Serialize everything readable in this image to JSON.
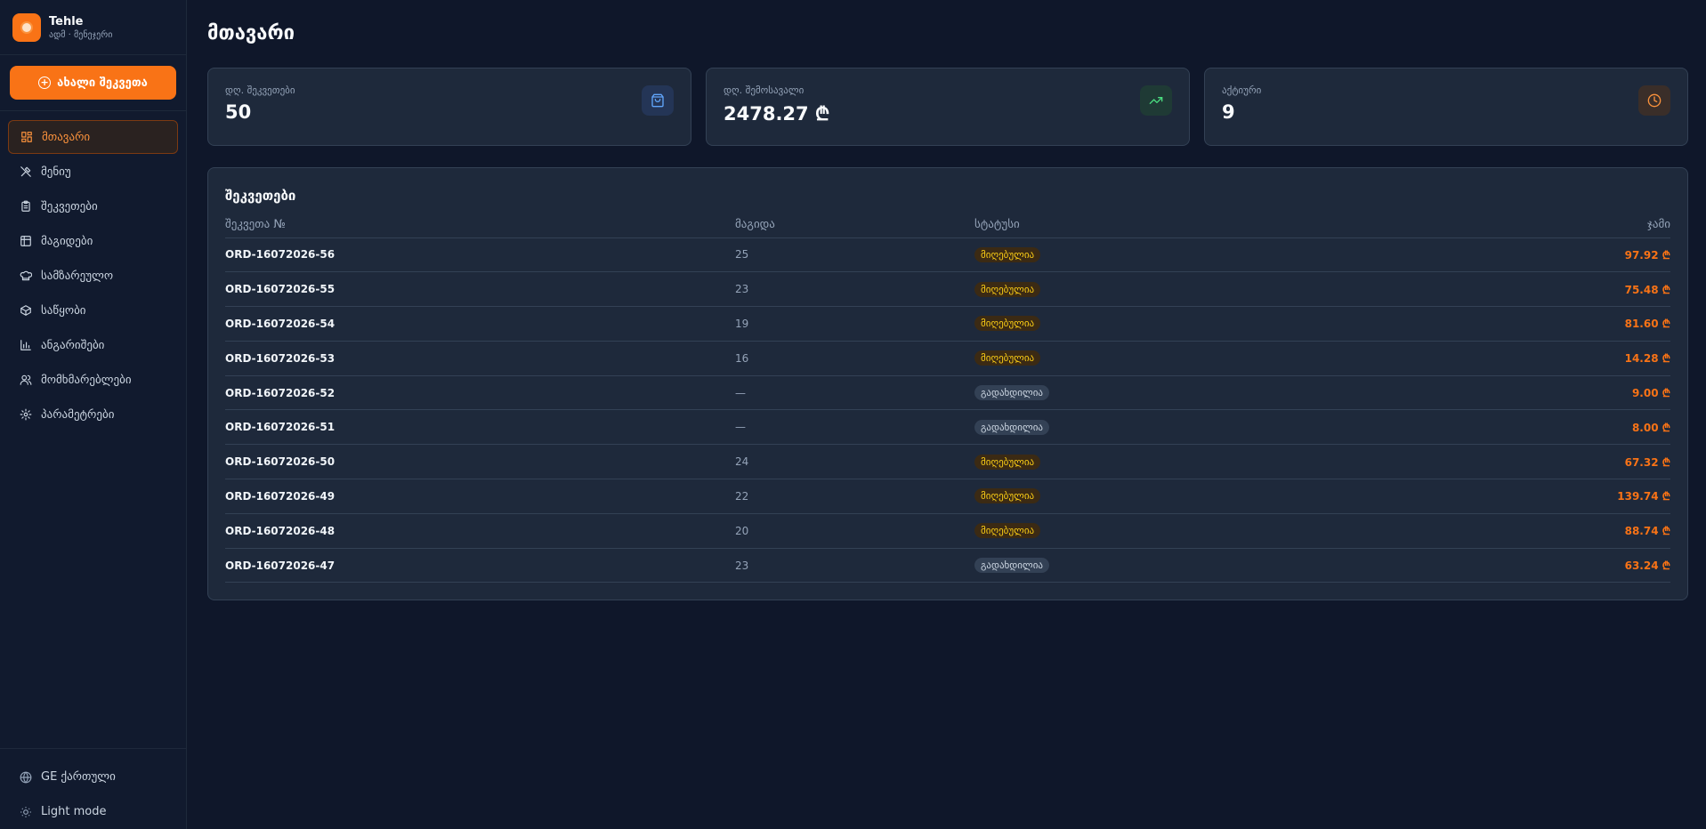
{
  "brand": {
    "name": "Tehle",
    "subtitle": "ადმ · მენეჯერი"
  },
  "new_order_label": "ახალი შეკვეთა",
  "nav": [
    {
      "label": "მთავარი",
      "icon": "grid-icon",
      "active": true
    },
    {
      "label": "მენიუ",
      "icon": "utensils-icon",
      "active": false
    },
    {
      "label": "შეკვეთები",
      "icon": "clipboard-icon",
      "active": false
    },
    {
      "label": "მაგიდები",
      "icon": "table-icon",
      "active": false
    },
    {
      "label": "სამზარეულო",
      "icon": "chef-hat-icon",
      "active": false
    },
    {
      "label": "საწყობი",
      "icon": "box-icon",
      "active": false
    },
    {
      "label": "ანგარიშები",
      "icon": "bar-chart-icon",
      "active": false
    },
    {
      "label": "მომხმარებლები",
      "icon": "users-icon",
      "active": false
    },
    {
      "label": "პარამეტრები",
      "icon": "gear-icon",
      "active": false
    }
  ],
  "footer": {
    "language": "GE ქართული",
    "theme": "Light mode"
  },
  "page_title": "მთავარი",
  "stats": [
    {
      "label": "დღ. შეკვეთები",
      "value": "50",
      "icon": "shopping-bag-icon",
      "icon_color": "#60a5fa",
      "icon_bg": "#243556"
    },
    {
      "label": "დღ. შემოსავალი",
      "value": "2478.27 ₾",
      "icon": "trending-up-icon",
      "icon_color": "#4ade80",
      "icon_bg": "#1f3a35"
    },
    {
      "label": "აქტიური",
      "value": "9",
      "icon": "clock-icon",
      "icon_color": "#fb923c",
      "icon_bg": "#3a2e29"
    }
  ],
  "orders": {
    "title": "შეკვეთები",
    "columns": [
      "შეკვეთა №",
      "მაგიდა",
      "სტატუსი",
      "ჯამი"
    ],
    "rows": [
      {
        "id": "ORD-16072026-56",
        "table": "25",
        "status": "მიღებულია",
        "kind": "accepted",
        "total": "97.92 ₾"
      },
      {
        "id": "ORD-16072026-55",
        "table": "23",
        "status": "მიღებულია",
        "kind": "accepted",
        "total": "75.48 ₾"
      },
      {
        "id": "ORD-16072026-54",
        "table": "19",
        "status": "მიღებულია",
        "kind": "accepted",
        "total": "81.60 ₾"
      },
      {
        "id": "ORD-16072026-53",
        "table": "16",
        "status": "მიღებულია",
        "kind": "accepted",
        "total": "14.28 ₾"
      },
      {
        "id": "ORD-16072026-52",
        "table": "—",
        "status": "გადახდილია",
        "kind": "delivered",
        "total": "9.00 ₾"
      },
      {
        "id": "ORD-16072026-51",
        "table": "—",
        "status": "გადახდილია",
        "kind": "delivered",
        "total": "8.00 ₾"
      },
      {
        "id": "ORD-16072026-50",
        "table": "24",
        "status": "მიღებულია",
        "kind": "accepted",
        "total": "67.32 ₾"
      },
      {
        "id": "ORD-16072026-49",
        "table": "22",
        "status": "მიღებულია",
        "kind": "accepted",
        "total": "139.74 ₾"
      },
      {
        "id": "ORD-16072026-48",
        "table": "20",
        "status": "მიღებულია",
        "kind": "accepted",
        "total": "88.74 ₾"
      },
      {
        "id": "ORD-16072026-47",
        "table": "23",
        "status": "გადახდილია",
        "kind": "delivered",
        "total": "63.24 ₾"
      }
    ]
  }
}
